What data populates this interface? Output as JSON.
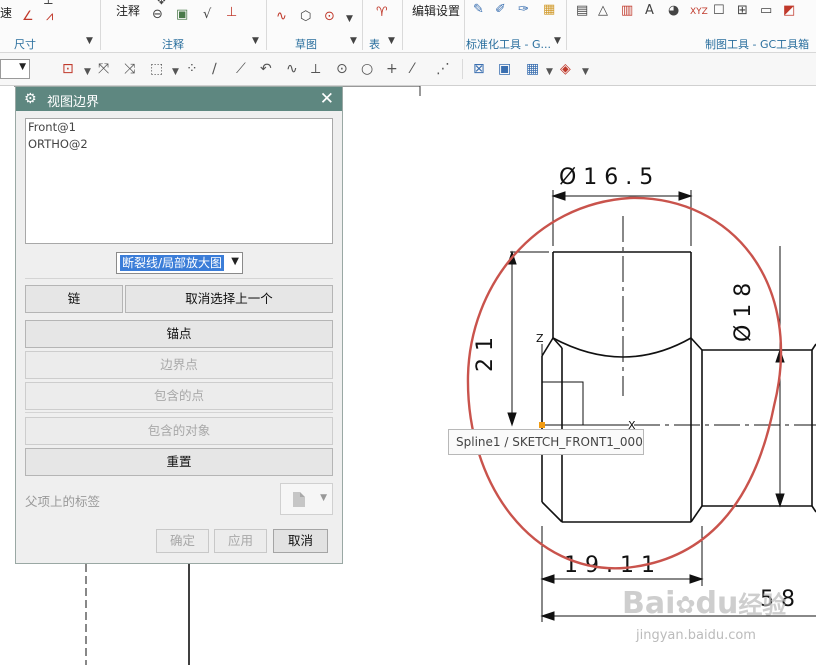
{
  "ribbon": {
    "left_partial": "速",
    "annotate_label": "注释",
    "edit_settings_label": "编辑设置",
    "groups": {
      "dimension": "尺寸",
      "annotation": "注释",
      "sketch": "草图",
      "table": "表",
      "gc_standard": "标准化工具 - G...",
      "gc_drafting": "制图工具 - GC工具箱"
    },
    "xyz_label": "XYZ"
  },
  "dialog": {
    "title": "视图边界",
    "views": [
      "Front@1",
      "ORTHO@2"
    ],
    "boundary_type": "断裂线/局部放大图",
    "chain_button": "链",
    "deselect_last_button": "取消选择上一个",
    "anchor_button": "锚点",
    "boundary_point_button": "边界点",
    "contained_points_button": "包含的点",
    "contained_objects_button": "包含的对象",
    "reset_button": "重置",
    "parent_label": "父项上的标签",
    "ok_button": "确定",
    "apply_button": "应用",
    "cancel_button": "取消"
  },
  "drawing": {
    "dim_top": "Ø 1 6 . 5",
    "dim_right": "Ø 1 8",
    "dim_left": "2 1",
    "dim_bottom": "1 9 . 1 1",
    "dim_bottom_right": "5 8",
    "axis_x": "X",
    "axis_z": "Z"
  },
  "tooltip": "Spline1 / SKETCH_FRONT1_000",
  "watermark": {
    "brand_1": "Bai",
    "brand_2": "du",
    "brand_cn": "经验",
    "url": "jingyan.baidu.com"
  },
  "colors": {
    "title_bar": "#5e8780",
    "selection": "#3b7dd8",
    "boundary_circle": "#c9534c"
  }
}
